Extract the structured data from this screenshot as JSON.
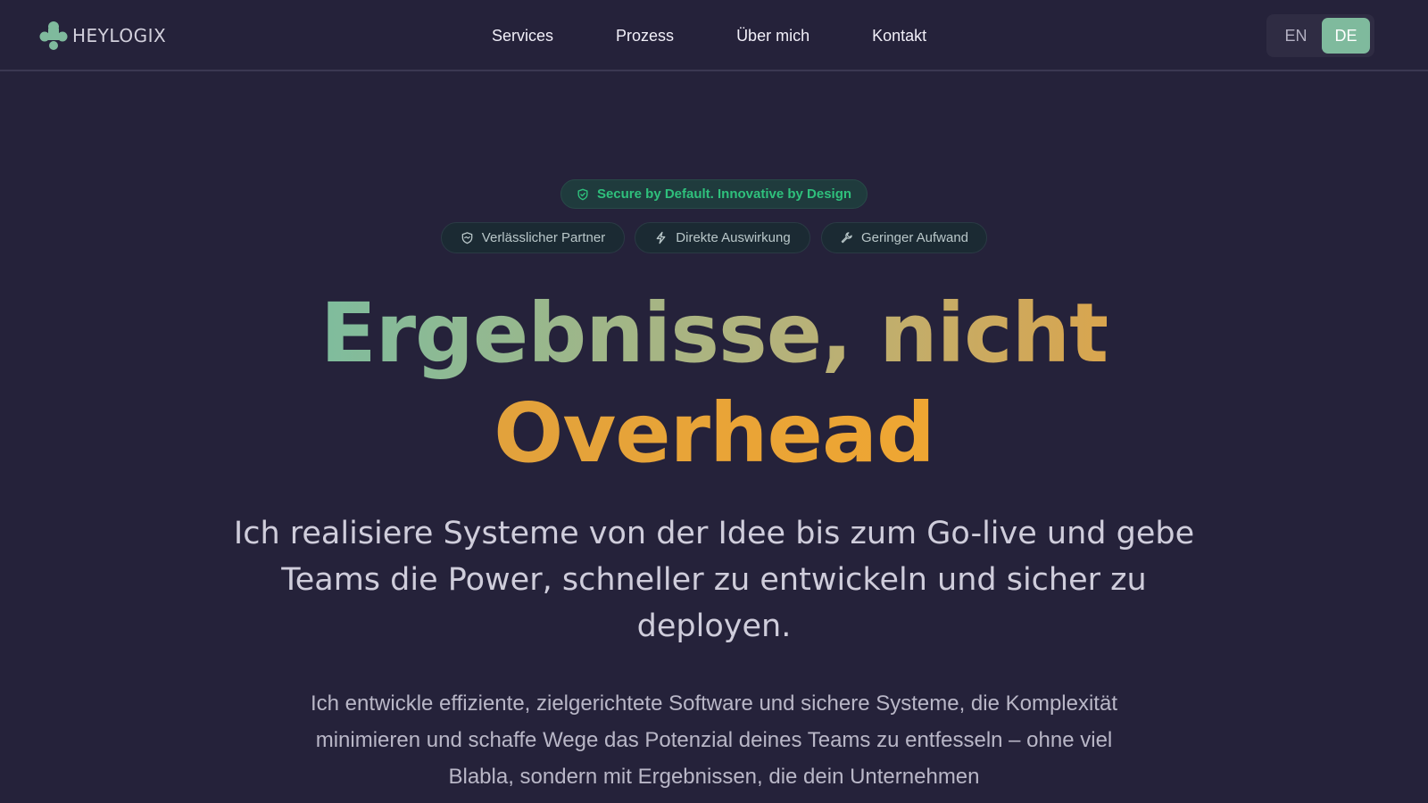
{
  "header": {
    "logo_text": "HEYLOGIX",
    "nav": [
      {
        "label": "Services"
      },
      {
        "label": "Prozess"
      },
      {
        "label": "Über mich"
      },
      {
        "label": "Kontakt"
      }
    ],
    "lang": {
      "en": "EN",
      "de": "DE",
      "active": "DE"
    }
  },
  "hero": {
    "badge": {
      "label": "Secure by Default. Innovative by Design",
      "icon": "shield-icon"
    },
    "chips": [
      {
        "label": "Verlässlicher Partner",
        "icon": "handshake-icon"
      },
      {
        "label": "Direkte Auswirkung",
        "icon": "lightning-icon"
      },
      {
        "label": "Geringer Aufwand",
        "icon": "wrench-icon"
      }
    ],
    "headline_line1": "Ergebnisse, nicht",
    "headline_line2": "Overhead",
    "subhead": "Ich realisiere Systeme von der Idee bis zum Go-live und gebe Teams die Power, schneller zu entwickeln und sicher zu deployen.",
    "body": "Ich entwickle effiziente, zielgerichtete Software und sichere Systeme, die Komplexität minimieren und schaffe Wege das Potenzial deines Teams zu entfesseln – ohne viel Blabla, sondern mit Ergebnissen, die dein Unternehmen"
  },
  "colors": {
    "background": "#25223a",
    "accent_green": "#7fba9d",
    "accent_orange": "#efa632",
    "badge_text": "#2fc07c"
  }
}
